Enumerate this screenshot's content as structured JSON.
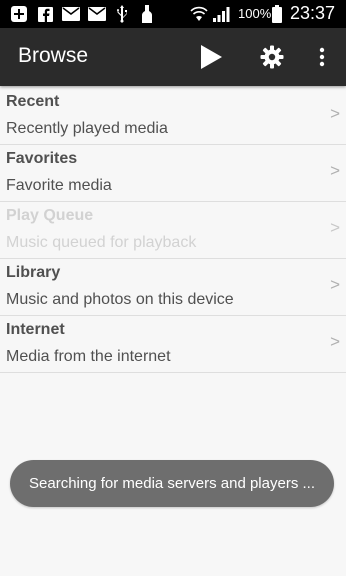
{
  "status_bar": {
    "icons": [
      "add-notification-icon",
      "facebook-icon",
      "mail-icon",
      "mail-icon",
      "usb-icon",
      "bottle-icon",
      "wifi-icon",
      "signal-icon",
      "battery-icon"
    ],
    "battery": "100%",
    "time": "23:37"
  },
  "app_bar": {
    "title": "Browse",
    "actions": [
      "play-icon",
      "settings-gear-icon",
      "overflow-menu-icon"
    ]
  },
  "list": {
    "items": [
      {
        "title": "Recent",
        "subtitle": "Recently played media",
        "chevron": ">",
        "enabled": true
      },
      {
        "title": "Favorites",
        "subtitle": "Favorite media",
        "chevron": ">",
        "enabled": true
      },
      {
        "title": "Play Queue",
        "subtitle": "Music queued for playback",
        "chevron": ">",
        "enabled": false
      },
      {
        "title": "Library",
        "subtitle": "Music and photos on this device",
        "chevron": ">",
        "enabled": true
      },
      {
        "title": "Internet",
        "subtitle": "Media from the internet",
        "chevron": ">",
        "enabled": true
      }
    ]
  },
  "toast": {
    "message": "Searching for media servers and players ..."
  },
  "colors": {
    "status_bar_bg": "#000000",
    "app_bar_bg": "#2b2b2b",
    "list_bg": "#f7f7f7",
    "text_primary": "#505050",
    "text_disabled": "#d2d2d2",
    "toast_bg": "#6e6e6e"
  }
}
